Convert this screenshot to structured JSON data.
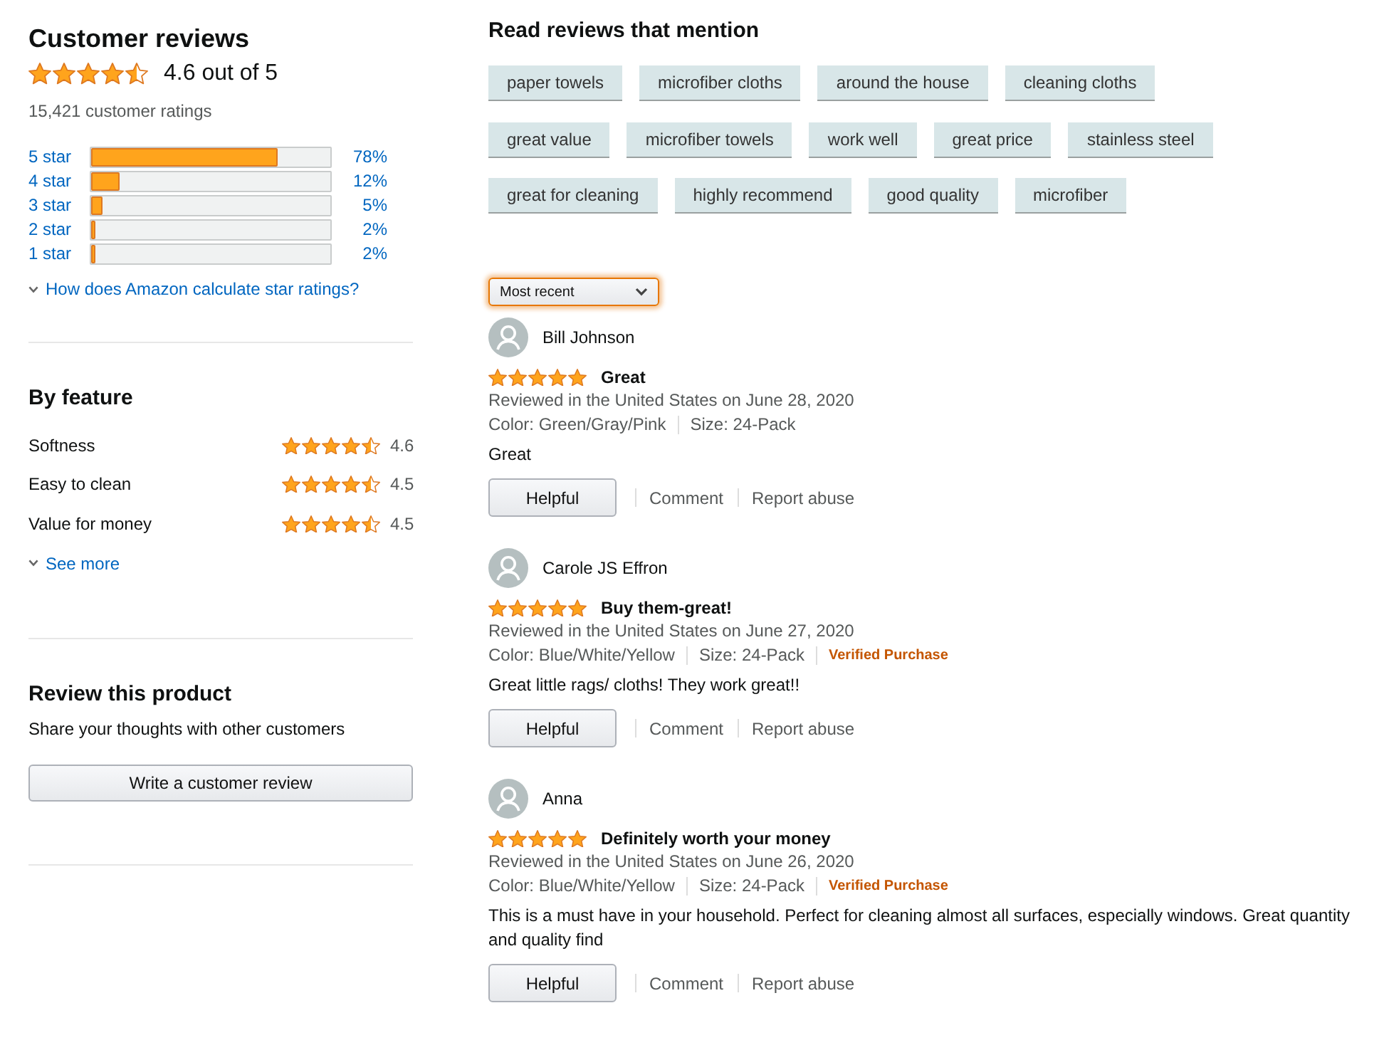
{
  "summary": {
    "title": "Customer reviews",
    "stars": 4.5,
    "rating": "4.6 out of 5",
    "ratings_count": "15,421 customer ratings"
  },
  "histogram": [
    {
      "label": "5 star",
      "level": 0.78,
      "percent": "78%"
    },
    {
      "label": "4 star",
      "level": 0.12,
      "percent": "12%"
    },
    {
      "label": "3 star",
      "level": 0.05,
      "percent": "5%"
    },
    {
      "label": "2 star",
      "level": 0.02,
      "percent": "2%"
    },
    {
      "label": "1 star",
      "level": 0.02,
      "percent": "2%"
    }
  ],
  "histogram_link": "How does Amazon calculate star ratings?",
  "by_feature": {
    "title": "By feature",
    "features": [
      {
        "name": "Softness",
        "stars": 4.5,
        "value": "4.6"
      },
      {
        "name": "Easy to clean",
        "stars": 4.5,
        "value": "4.5"
      },
      {
        "name": "Value for money",
        "stars": 4.5,
        "value": "4.5"
      }
    ],
    "see_more": "See more"
  },
  "review_this_product": {
    "title": "Review this product",
    "subtitle": "Share your thoughts with other customers",
    "button": "Write a customer review"
  },
  "mentions": {
    "title": "Read reviews that mention",
    "rows": [
      [
        "paper towels",
        "microfiber cloths",
        "around the house",
        "cleaning cloths"
      ],
      [
        "great value",
        "microfiber towels",
        "work well",
        "great price",
        "stainless steel"
      ],
      [
        "great for cleaning",
        "highly recommend",
        "good quality",
        "microfiber"
      ]
    ]
  },
  "sort": {
    "value": "Most recent"
  },
  "reviews": [
    {
      "author": "Bill Johnson",
      "stars": 5,
      "title": "Great",
      "date": "Reviewed in the United States on June 28, 2020",
      "variant": "Color: Green/Gray/Pink",
      "size": "Size: 24-Pack",
      "body": "Great",
      "actions": [
        {
          "kind": "button",
          "label": "Helpful"
        },
        {
          "kind": "link",
          "label": "Comment"
        },
        {
          "kind": "link",
          "label": "Report abuse"
        }
      ]
    },
    {
      "author": "Carole JS Effron",
      "stars": 5,
      "title": "Buy them-great!",
      "date": "Reviewed in the United States on June 27, 2020",
      "variant": "Color: Blue/White/Yellow",
      "size": "Size: 24-Pack",
      "badge": "Verified Purchase",
      "body": "Great little rags/ cloths! They work great!!",
      "actions": [
        {
          "kind": "button",
          "label": "Helpful"
        },
        {
          "kind": "link",
          "label": "Comment"
        },
        {
          "kind": "link",
          "label": "Report abuse"
        }
      ]
    },
    {
      "author": "Anna",
      "stars": 5,
      "title": "Definitely worth your money",
      "date": "Reviewed in the United States on June 26, 2020",
      "variant": "Color: Blue/White/Yellow",
      "size": "Size: 24-Pack",
      "badge": "Verified Purchase",
      "body": "This is a must have in your household. Perfect for cleaning almost all surfaces, especially windows. Great quantity and quality find",
      "actions": [
        {
          "kind": "button",
          "label": "Helpful"
        },
        {
          "kind": "link",
          "label": "Comment"
        },
        {
          "kind": "link",
          "label": "Report abuse"
        }
      ]
    }
  ]
}
